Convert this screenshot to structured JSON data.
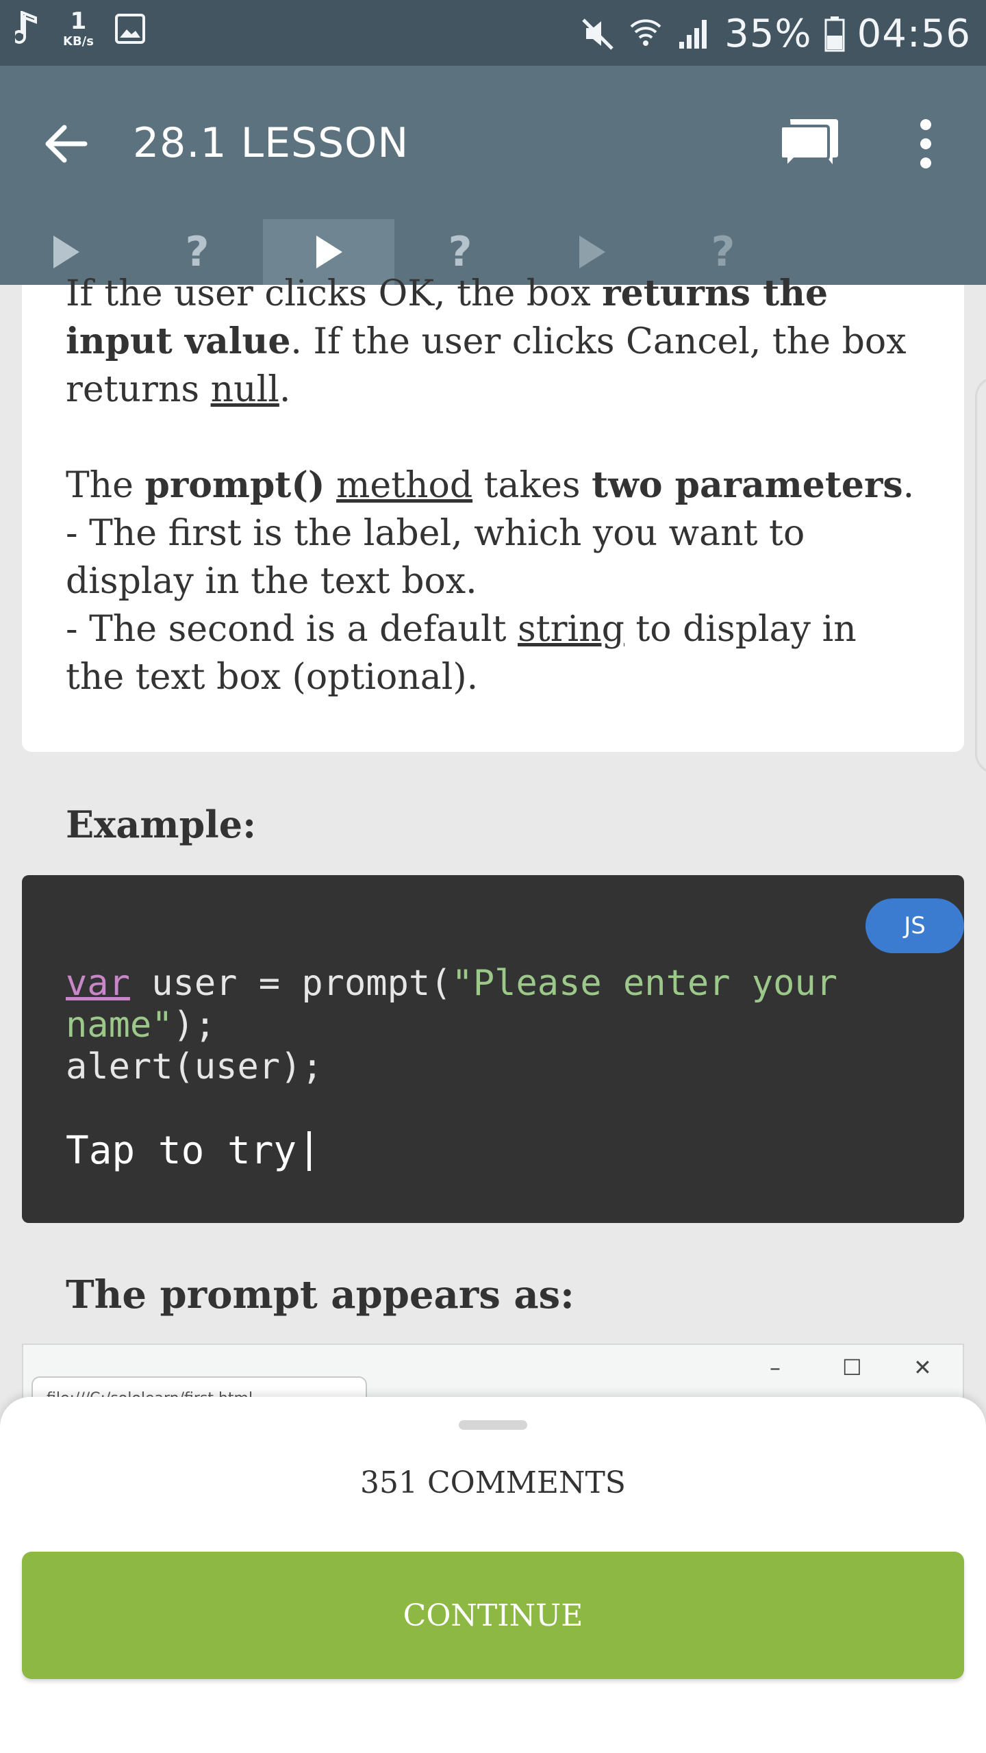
{
  "status_bar": {
    "net_speed_value": "1",
    "net_speed_unit": "KB/s",
    "battery": "35%",
    "time": "04:56"
  },
  "app_bar": {
    "title": "28.1 LESSON"
  },
  "tabs": [
    {
      "icon": "play-icon",
      "state": "done"
    },
    {
      "label": "?",
      "state": "done"
    },
    {
      "icon": "play-icon",
      "state": "active"
    },
    {
      "label": "?",
      "state": "done"
    },
    {
      "icon": "play-icon",
      "state": "locked"
    },
    {
      "label": "?",
      "state": "locked"
    }
  ],
  "lesson": {
    "p1": {
      "t1": "If the user clicks OK, the box ",
      "b1": "returns the input value",
      "t2": ". If the user clicks Cancel, the box returns ",
      "u1": "null",
      "t3": "."
    },
    "p2": {
      "t1": "The ",
      "b1": "prompt()",
      "t2": " ",
      "u1": "method",
      "t3": " takes ",
      "b2": "two parameters",
      "t4": ".",
      "line2": "- The first is the label, which you want to display in the text box.",
      "line3a": "- The second is a default ",
      "line3u": "string",
      "line3b": " to display in the text box (optional)."
    }
  },
  "example_label": "Example:",
  "code": {
    "badge": "JS",
    "kw": "var",
    "part1": " user = prompt(",
    "str1": "\"Please enter your",
    "str2": "name\"",
    "part2": ");",
    "line3": "alert(user);",
    "tap": "Tap to try"
  },
  "prompt_label": "The prompt appears as:",
  "preview": {
    "tab_text": "file:///C:/sololearn/first.html",
    "minimize": "–",
    "maximize": "☐",
    "close": "✕"
  },
  "sheet": {
    "comments": "351 COMMENTS",
    "continue": "CONTINUE"
  }
}
